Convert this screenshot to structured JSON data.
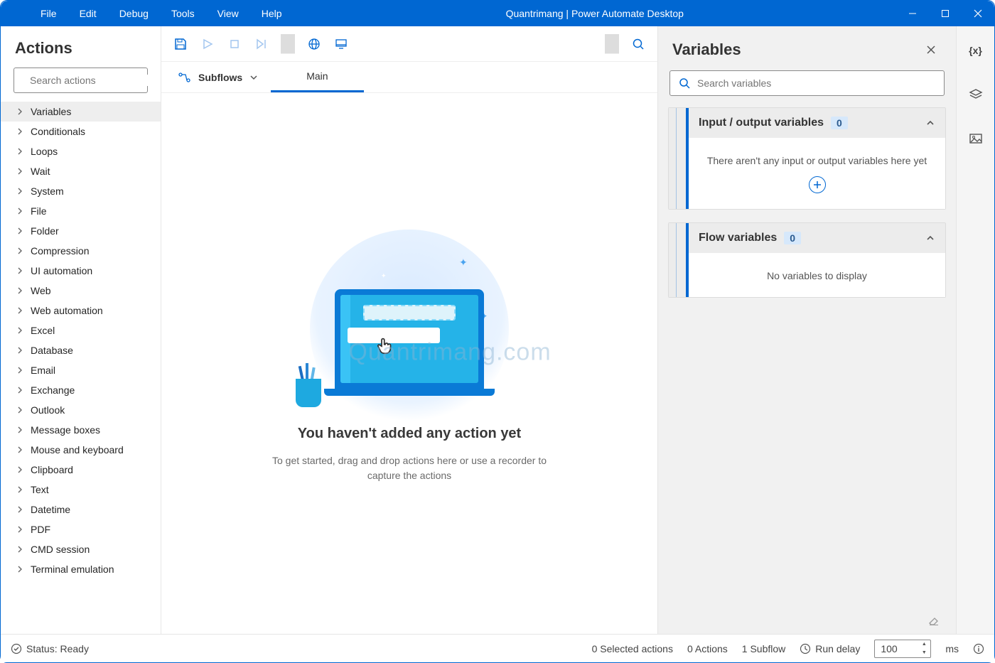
{
  "title": "Quantrimang | Power Automate Desktop",
  "menu": [
    "File",
    "Edit",
    "Debug",
    "Tools",
    "View",
    "Help"
  ],
  "actions": {
    "panel_title": "Actions",
    "search_placeholder": "Search actions",
    "categories": [
      "Variables",
      "Conditionals",
      "Loops",
      "Wait",
      "System",
      "File",
      "Folder",
      "Compression",
      "UI automation",
      "Web",
      "Web automation",
      "Excel",
      "Database",
      "Email",
      "Exchange",
      "Outlook",
      "Message boxes",
      "Mouse and keyboard",
      "Clipboard",
      "Text",
      "Datetime",
      "PDF",
      "CMD session",
      "Terminal emulation"
    ]
  },
  "tabs": {
    "subflows_label": "Subflows",
    "main_label": "Main"
  },
  "canvas": {
    "empty_title": "You haven't added any action yet",
    "empty_sub": "To get started, drag and drop actions here or use a recorder to capture the actions",
    "watermark": "Quantrimang.com"
  },
  "variables": {
    "panel_title": "Variables",
    "search_placeholder": "Search variables",
    "io_label": "Input / output variables",
    "io_count": "0",
    "io_empty": "There aren't any input or output variables here yet",
    "flow_label": "Flow variables",
    "flow_count": "0",
    "flow_empty": "No variables to display"
  },
  "status": {
    "ready": "Status: Ready",
    "selected": "0 Selected actions",
    "actions": "0 Actions",
    "subflows": "1 Subflow",
    "run_delay": "Run delay",
    "delay_value": "100",
    "ms": "ms"
  }
}
